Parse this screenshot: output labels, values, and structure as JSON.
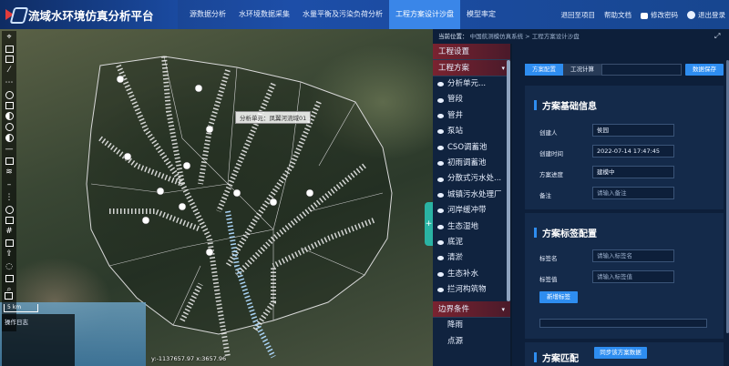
{
  "header": {
    "title": "流域水环境仿真分析平台",
    "nav": [
      "源数据分析",
      "水环境数据采集",
      "水量平衡及污染负荷分析",
      "工程方案设计沙盘",
      "模型率定"
    ],
    "active_nav": 3,
    "actions": {
      "back": "退回至项目",
      "help": "帮助文档",
      "change_password": "修改密码",
      "logout": "退出登录"
    }
  },
  "map": {
    "tooltip": "分析单元：凤翼河流域01",
    "scale": "5 km",
    "coordinate": "y:-1137657.97 x:3657.96",
    "oplog_title": "操作日志"
  },
  "breadcrumb": {
    "prefix": "当前位置：",
    "system": "中国航测模仿真系统",
    "sep": ">",
    "page": "工程方案设计沙盘"
  },
  "tree": {
    "header": "工程设置",
    "section1": "工程方案",
    "items": [
      "分析单元...",
      "管段",
      "管井",
      "泵站",
      "CSO调蓄池",
      "初雨调蓄池",
      "分散式污水处...",
      "城镇污水处理厂",
      "河岸缓冲带",
      "生态湿地",
      "底泥",
      "清淤",
      "生态补水",
      "拦河构筑物"
    ],
    "section2": "边界条件",
    "items2": [
      "降雨",
      "点源"
    ]
  },
  "panel": {
    "tabs": [
      "方案配置",
      "工况计算"
    ],
    "active_tab": 0,
    "save_label": "数据保存",
    "basic": {
      "title": "方案基础信息",
      "fields": [
        {
          "label": "创建人",
          "value": "侯园",
          "placeholder": ""
        },
        {
          "label": "创建时间",
          "value": "2022-07-14 17:47:45",
          "placeholder": ""
        },
        {
          "label": "方案进度",
          "value": "建模中",
          "placeholder": ""
        },
        {
          "label": "备注",
          "value": "",
          "placeholder": "请输入备注"
        }
      ]
    },
    "tags": {
      "title": "方案标签配置",
      "fields": [
        {
          "label": "标签名",
          "value": "",
          "placeholder": "请输入标签名"
        },
        {
          "label": "标签值",
          "value": "",
          "placeholder": "请输入标签值"
        }
      ],
      "add_label": "新增标签"
    },
    "match": {
      "title": "方案匹配",
      "sync_label": "同步该方案数据"
    }
  }
}
